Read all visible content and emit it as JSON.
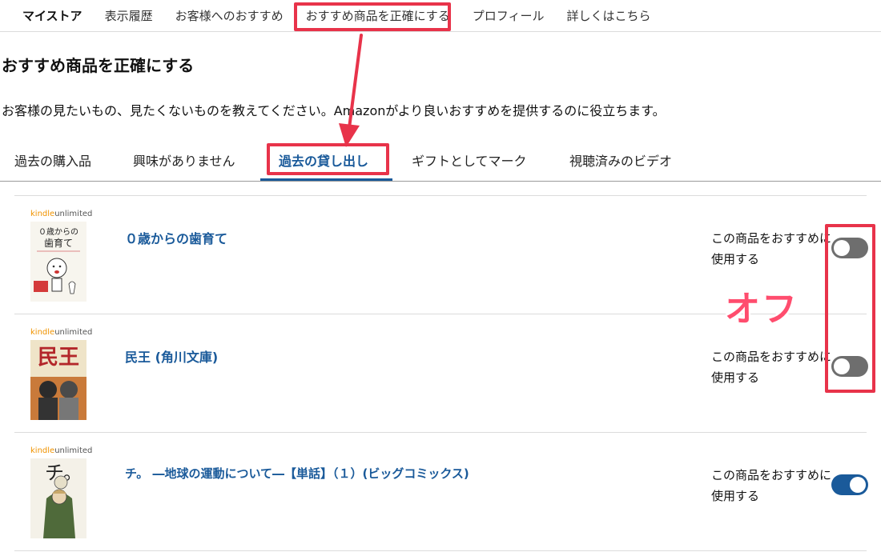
{
  "nav": {
    "items": [
      "マイストア",
      "表示履歴",
      "お客様へのおすすめ",
      "おすすめ商品を正確にする",
      "プロフィール",
      "詳しくはこちら"
    ]
  },
  "page": {
    "title": "おすすめ商品を正確にする",
    "description": "お客様の見たいもの、見たくないものを教えてください。Amazonがより良いおすすめを提供するのに役立ちます。"
  },
  "tabs": [
    "過去の購入品",
    "興味がありません",
    "過去の貸し出し",
    "ギフトとしてマーク",
    "視聴済みのビデオ"
  ],
  "active_tab": "過去の貸し出し",
  "ku_label": {
    "kindle": "kindle",
    "unlimited": "unlimited"
  },
  "items": [
    {
      "title": "０歳からの歯育て",
      "pref_label": "この商品をおすすめに使用する",
      "toggle_state": "off",
      "cover_text": "０歳からの歯育て"
    },
    {
      "title": "民王 (角川文庫)",
      "pref_label": "この商品をおすすめに使用する",
      "toggle_state": "off",
      "cover_text": "民王"
    },
    {
      "title": "チ。 ―地球の運動について―【単話】（１）(ビッグコミックス)",
      "pref_label": "この商品をおすすめに使用する",
      "toggle_state": "on",
      "cover_text": "チ。"
    }
  ],
  "annotation": {
    "off_text": "オフ",
    "highlight_color": "#e8334a"
  },
  "colors": {
    "link": "#1a5a9a",
    "toggle_off": "#6e6e6e",
    "toggle_on": "#1a5a9a",
    "kindle_orange": "#f09300"
  }
}
